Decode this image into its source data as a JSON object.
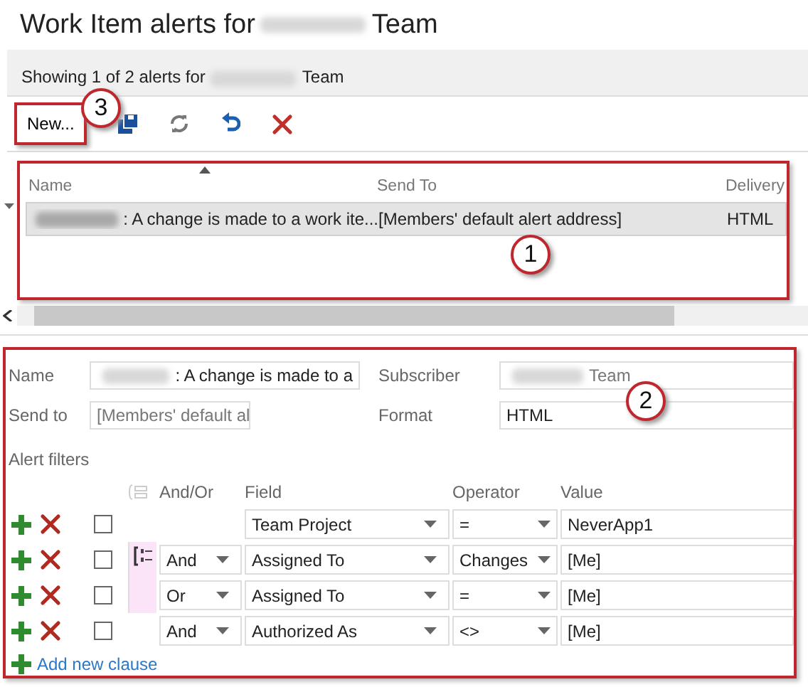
{
  "page_title": {
    "prefix": "Work Item alerts for",
    "suffix": "Team"
  },
  "status": {
    "prefix": "Showing 1 of 2 alerts for",
    "suffix": "Team"
  },
  "toolbar": {
    "new_label": "New...",
    "callout": "3"
  },
  "alert_list": {
    "callout": "1",
    "columns": [
      "Name",
      "Send To",
      "Delivery"
    ],
    "rows": [
      {
        "name": ": A change is made to a work ite...",
        "send_to": "[Members' default alert address]",
        "delivery": "HTML",
        "selected": true
      }
    ]
  },
  "details": {
    "callout": "2",
    "name_label": "Name",
    "name_value": ": A change is made to a",
    "subscriber_label": "Subscriber",
    "subscriber_value": "Team",
    "send_to_label": "Send to",
    "send_to_value": "[Members' default al",
    "format_label": "Format",
    "format_value": "HTML",
    "filters_label": "Alert filters",
    "columns": [
      "And/Or",
      "Field",
      "Operator",
      "Value"
    ],
    "clauses": [
      {
        "field": "Team Project",
        "operator": "=",
        "value": "NeverApp1",
        "checked": false,
        "grouped": false
      },
      {
        "and_or": "And",
        "field": "Assigned To",
        "operator": "Changes",
        "value": "[Me]",
        "checked": false,
        "grouped": true
      },
      {
        "and_or": "Or",
        "field": "Assigned To",
        "operator": "=",
        "value": "[Me]",
        "checked": false,
        "grouped": true
      },
      {
        "and_or": "And",
        "field": "Authorized As",
        "operator": "<>",
        "value": "[Me]",
        "checked": false,
        "grouped": false
      }
    ],
    "add_clause": "Add new clause"
  }
}
